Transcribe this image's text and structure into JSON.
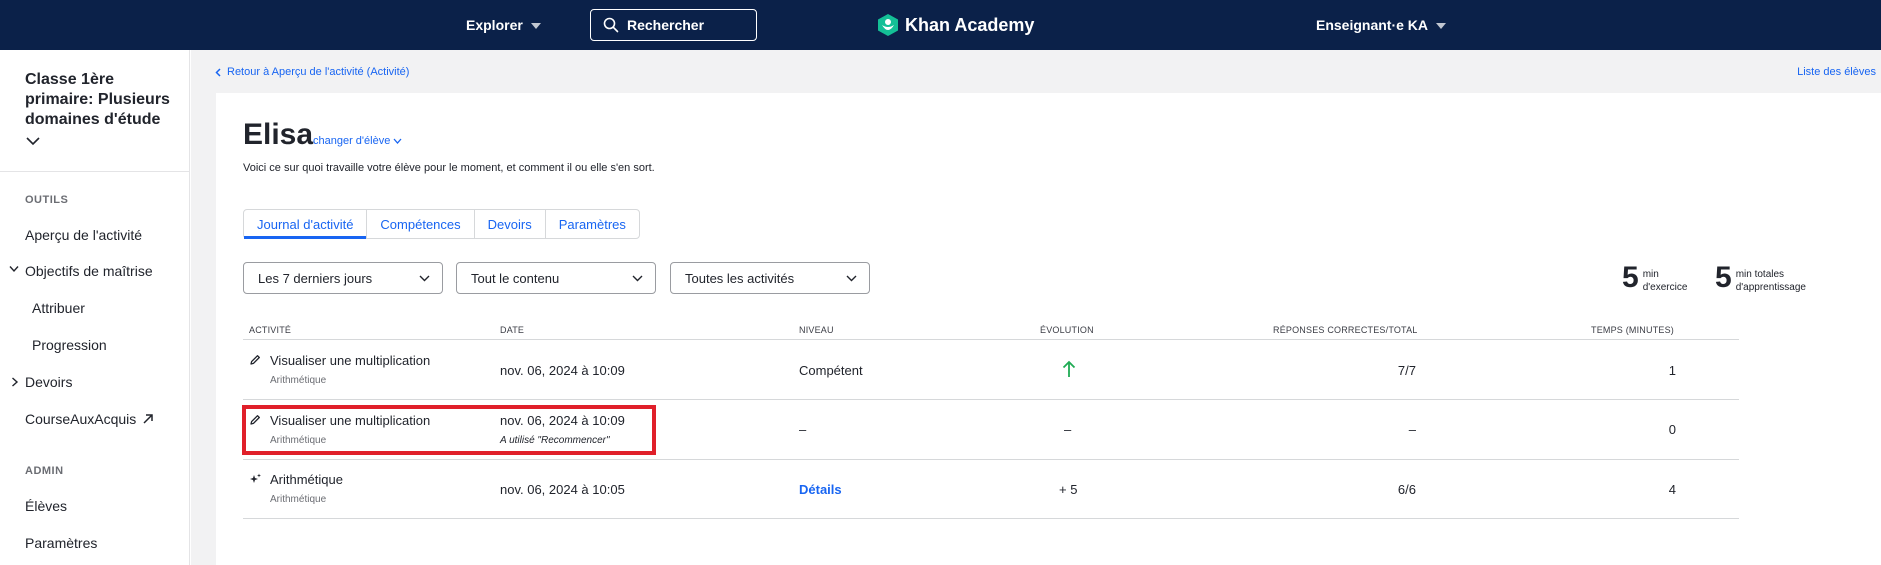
{
  "topbar": {
    "explore_label": "Explorer",
    "search_label": "Rechercher",
    "logo_text": "Khan Academy",
    "user_label": "Enseignant·e KA"
  },
  "sidebar": {
    "class_title": "Classe 1ère primaire: Plusieurs domaines d'étude",
    "tools_label": "OUTILS",
    "items": [
      {
        "label": "Aperçu de l'activité"
      },
      {
        "label": "Objectifs de maîtrise"
      },
      {
        "label": "Attribuer"
      },
      {
        "label": "Progression"
      },
      {
        "label": "Devoirs"
      },
      {
        "label": "CourseAuxAcquis"
      }
    ],
    "admin_label": "ADMIN",
    "admin_items": [
      {
        "label": "Élèves"
      },
      {
        "label": "Paramètres"
      }
    ]
  },
  "header": {
    "back_link": "Retour à Aperçu de l'activité (Activité)",
    "students_link": "Liste des élèves",
    "student_name": "Elisa",
    "change_student": "changer d'élève",
    "intro": "Voici ce sur quoi travaille votre élève pour le moment, et comment il ou elle s'en sort."
  },
  "tabs": [
    {
      "label": "Journal d'activité",
      "active": true
    },
    {
      "label": "Compétences"
    },
    {
      "label": "Devoirs"
    },
    {
      "label": "Paramètres"
    }
  ],
  "filters": {
    "period": "Les 7 derniers jours",
    "content": "Tout le contenu",
    "activities": "Toutes les activités"
  },
  "stats": [
    {
      "value": "5",
      "unit": "min",
      "label": "d'exercice"
    },
    {
      "value": "5",
      "unit": "min totales",
      "label": "d'apprentissage"
    }
  ],
  "table": {
    "headers": [
      "ACTIVITÉ",
      "DATE",
      "NIVEAU",
      "ÉVOLUTION",
      "RÉPONSES CORRECTES/TOTAL",
      "TEMPS (MINUTES)"
    ],
    "rows": [
      {
        "icon": "pencil-icon",
        "activity": "Visualiser une multiplication",
        "subject": "Arithmétique",
        "date": "nov. 06, 2024 à 10:09",
        "level": "Compétent",
        "evolution": "arrow-up",
        "correct": "7/7",
        "time": "1"
      },
      {
        "icon": "pencil-icon",
        "activity": "Visualiser une multiplication",
        "subject": "Arithmétique",
        "date": "nov. 06, 2024 à 10:09",
        "note": "A utilisé \"Recommencer\"",
        "level": "–",
        "evolution": "–",
        "correct": "–",
        "time": "0"
      },
      {
        "icon": "sparkle-icon",
        "activity": "Arithmétique",
        "subject": "Arithmétique",
        "date": "nov. 06, 2024 à 10:05",
        "level": "Détails",
        "evolution": "+ 5",
        "correct": "6/6",
        "time": "4"
      }
    ]
  },
  "colors": {
    "topbar": "#0b2149",
    "link": "#1865f2",
    "highlight": "#e0202a",
    "up_arrow": "#1fab54"
  }
}
